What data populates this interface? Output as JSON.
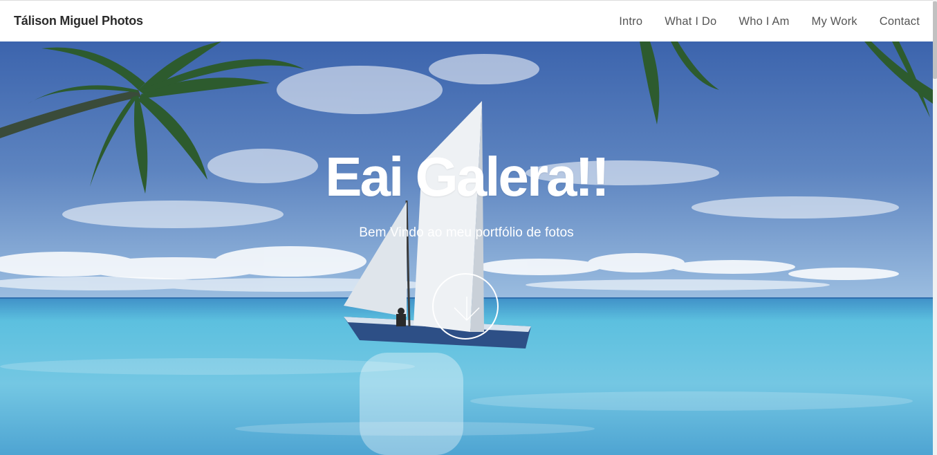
{
  "site": {
    "brand": "Tálison Miguel Photos"
  },
  "nav": {
    "items": [
      {
        "label": "Intro"
      },
      {
        "label": "What I Do"
      },
      {
        "label": "Who I Am"
      },
      {
        "label": "My Work"
      },
      {
        "label": "Contact"
      }
    ]
  },
  "hero": {
    "title": "Eai Galera!!",
    "subtitle": "Bem Vindo ao meu portfólio de fotos",
    "scroll_icon": "chevron-down-icon"
  },
  "colors": {
    "sky": "#4d74b3",
    "sea": "#5fb3d6",
    "navbar_bg": "#ffffff",
    "brand_text": "#2b2b2b",
    "nav_text": "#555555",
    "hero_text": "#ffffff"
  }
}
